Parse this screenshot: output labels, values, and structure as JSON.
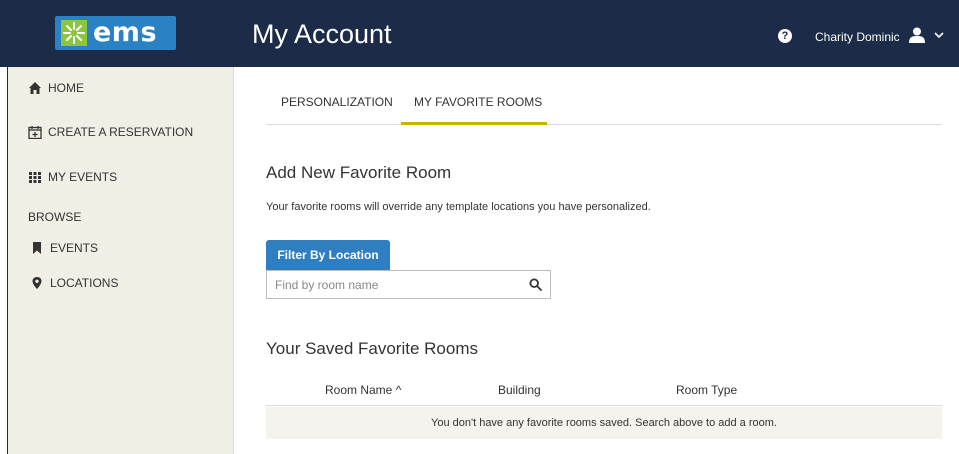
{
  "header": {
    "logo_text": "ems",
    "title": "My Account",
    "help_symbol": "?",
    "user_name": "Charity Dominic",
    "icons": {
      "help": "help-icon",
      "user": "user-icon",
      "menu": "chevron-down-icon"
    }
  },
  "sidebar": {
    "items": [
      {
        "label": "HOME",
        "icon": "home-icon"
      },
      {
        "label": "CREATE A RESERVATION",
        "icon": "calendar-plus-icon"
      },
      {
        "label": "MY EVENTS",
        "icon": "grid-icon"
      }
    ],
    "browse_label": "BROWSE",
    "browse_items": [
      {
        "label": "EVENTS",
        "icon": "bookmark-icon"
      },
      {
        "label": "LOCATIONS",
        "icon": "map-marker-icon"
      }
    ]
  },
  "tabs": [
    {
      "label": "PERSONALIZATION",
      "active": false
    },
    {
      "label": "MY FAVORITE ROOMS",
      "active": true
    }
  ],
  "add_section": {
    "heading": "Add New Favorite Room",
    "note": "Your favorite rooms will override any template locations you have personalized.",
    "filter_button": "Filter By Location",
    "search_placeholder": "Find by room name"
  },
  "saved_section": {
    "heading": "Your Saved Favorite Rooms",
    "columns": [
      "Room Name ^",
      "Building",
      "Room Type"
    ],
    "empty_message": "You don't have any favorite rooms saved. Search above to add a room."
  },
  "colors": {
    "topbar": "#1b2b48",
    "logo": "#2a82c5",
    "sidebar": "#f0efe6",
    "tab_underline": "#c8b400",
    "button": "#2f7ec0"
  }
}
